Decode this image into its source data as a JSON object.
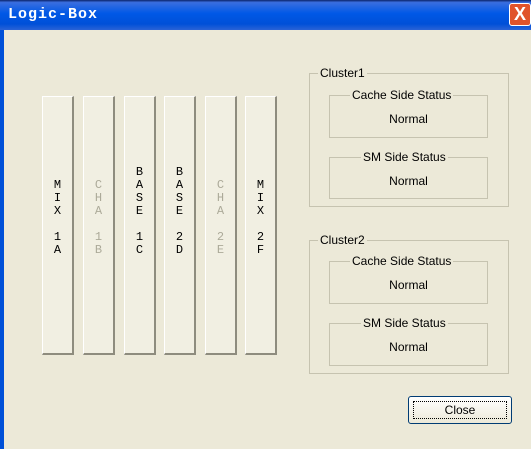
{
  "window": {
    "title": "Logic-Box",
    "close_glyph": "X"
  },
  "slots": [
    {
      "lines": [
        "M",
        "I",
        "X",
        "",
        "1",
        "A"
      ],
      "enabled": true
    },
    {
      "lines": [
        "C",
        "H",
        "A",
        "",
        "1",
        "B"
      ],
      "enabled": false
    },
    {
      "lines": [
        "B",
        "A",
        "S",
        "E",
        "",
        "1",
        "C"
      ],
      "enabled": true
    },
    {
      "lines": [
        "B",
        "A",
        "S",
        "E",
        "",
        "2",
        "D"
      ],
      "enabled": true
    },
    {
      "lines": [
        "C",
        "H",
        "A",
        "",
        "2",
        "E"
      ],
      "enabled": false
    },
    {
      "lines": [
        "M",
        "I",
        "X",
        "",
        "2",
        "F"
      ],
      "enabled": true
    }
  ],
  "clusters": [
    {
      "label": "Cluster1",
      "cache_label": "Cache Side Status",
      "cache_value": "Normal",
      "sm_label": "SM Side Status",
      "sm_value": "Normal"
    },
    {
      "label": "Cluster2",
      "cache_label": "Cache Side Status",
      "cache_value": "Normal",
      "sm_label": "SM Side Status",
      "sm_value": "Normal"
    }
  ],
  "buttons": {
    "close_label": "Close"
  }
}
